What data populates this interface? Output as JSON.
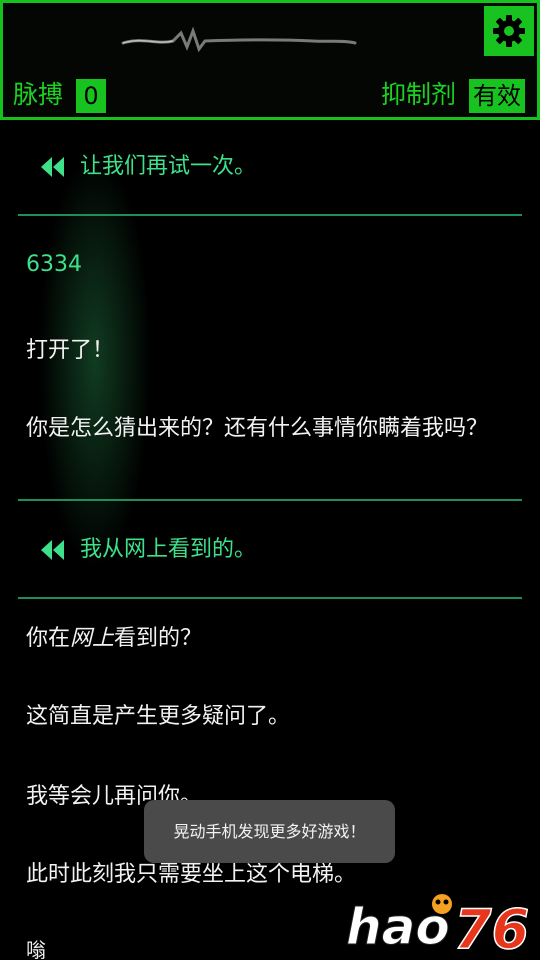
{
  "header": {
    "pulse_label": "脉搏",
    "pulse_value": "0",
    "suppressant_label": "抑制剂",
    "suppressant_value": "有效",
    "settings_icon": "gear-icon",
    "accent_color": "#18c21f"
  },
  "conversation": {
    "choice_1": "让我们再试一次。",
    "msg_code": "6334",
    "msg_opened": "打开了！",
    "msg_question": "你是怎么猜出来的？还有什么事情你瞒着我吗？",
    "choice_2": "我从网上看到的。",
    "msg_online_prefix": "你在",
    "msg_online_em": "网上",
    "msg_online_suffix": "看到的？",
    "msg_more_questions": "这简直是产生更多疑问了。",
    "msg_ask_later": "我等会儿再问你。",
    "msg_elevator": "此时此刻我只需要坐上这个电梯。",
    "msg_partial": "嗡",
    "choice_icon": "double-chevron-left-icon",
    "choice_color": "#3ee08a"
  },
  "toast": {
    "text": "晃动手机发现更多好游戏！"
  },
  "watermark": {
    "text": "hao76"
  }
}
